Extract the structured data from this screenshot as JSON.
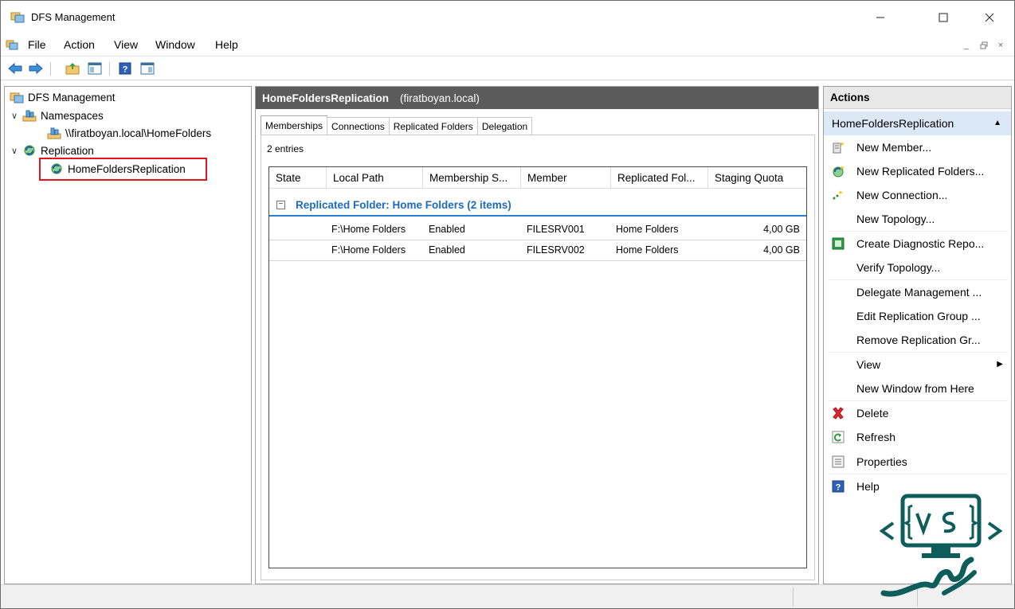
{
  "window": {
    "title": "DFS Management",
    "controls": {
      "minimize": "—",
      "maximize": "☐",
      "close": "✕"
    }
  },
  "menu": {
    "items": [
      "File",
      "Action",
      "View",
      "Window",
      "Help"
    ],
    "mdi_controls": [
      "_",
      "͡",
      "×"
    ]
  },
  "toolbar": {
    "buttons": [
      "back-arrow-icon",
      "forward-arrow-icon",
      "up-folder-icon",
      "show-hide-console-tree-icon",
      "help-icon",
      "show-hide-action-pane-icon"
    ]
  },
  "tree": {
    "root": "DFS Management",
    "namespaces": "Namespaces",
    "namespace_path": "\\\\firatboyan.local\\HomeFolders",
    "replication": "Replication",
    "replication_group": "HomeFoldersReplication"
  },
  "center": {
    "header_name": "HomeFoldersReplication",
    "header_domain": "(firatboyan.local)",
    "tabs": [
      "Memberships",
      "Connections",
      "Replicated Folders",
      "Delegation"
    ],
    "active_tab": "Memberships",
    "entries": "2 entries",
    "columns": [
      "State",
      "Local Path",
      "Membership S...",
      "Member",
      "Replicated Fol...",
      "Staging Quota"
    ],
    "group_label": "Replicated Folder: Home Folders (2 items)",
    "group_toggle": "−",
    "rows": [
      {
        "state": "",
        "local_path": "F:\\Home Folders",
        "membership": "Enabled",
        "member": "FILESRV001",
        "replicated_folder": "Home Folders",
        "staging_quota": "4,00 GB"
      },
      {
        "state": "",
        "local_path": "F:\\Home Folders",
        "membership": "Enabled",
        "member": "FILESRV002",
        "replicated_folder": "Home Folders",
        "staging_quota": "4,00 GB"
      }
    ]
  },
  "actions": {
    "title": "Actions",
    "section": "HomeFoldersReplication",
    "section_toggle": "▲",
    "submenu_arrow": "▶",
    "items": [
      {
        "label": "New Member...",
        "icon": "new-member-icon"
      },
      {
        "label": "New Replicated Folders...",
        "icon": "new-replicated-folders-icon"
      },
      {
        "label": "New Connection...",
        "icon": "new-connection-icon"
      },
      {
        "label": "New Topology...",
        "icon": ""
      },
      {
        "label": "Create Diagnostic Repo...",
        "icon": "diagnostic-report-icon"
      },
      {
        "label": "Verify Topology...",
        "icon": ""
      },
      {
        "label": "Delegate Management ...",
        "icon": ""
      },
      {
        "label": "Edit Replication Group ...",
        "icon": ""
      },
      {
        "label": "Remove Replication Gr...",
        "icon": ""
      },
      {
        "label": "View",
        "icon": "",
        "submenu": true
      },
      {
        "label": "New Window from Here",
        "icon": ""
      },
      {
        "label": "Delete",
        "icon": "delete-icon"
      },
      {
        "label": "Refresh",
        "icon": "refresh-icon"
      },
      {
        "label": "Properties",
        "icon": "properties-icon"
      },
      {
        "label": "Help",
        "icon": "help-icon"
      }
    ]
  },
  "colors": {
    "header_bg": "#5b5b5b",
    "group_text": "#1c6bbf",
    "group_line": "#2a7fd4",
    "highlight_box": "#e0151f",
    "actions_section_bg": "#dbe8f6",
    "logo": "#0d5d5a"
  }
}
